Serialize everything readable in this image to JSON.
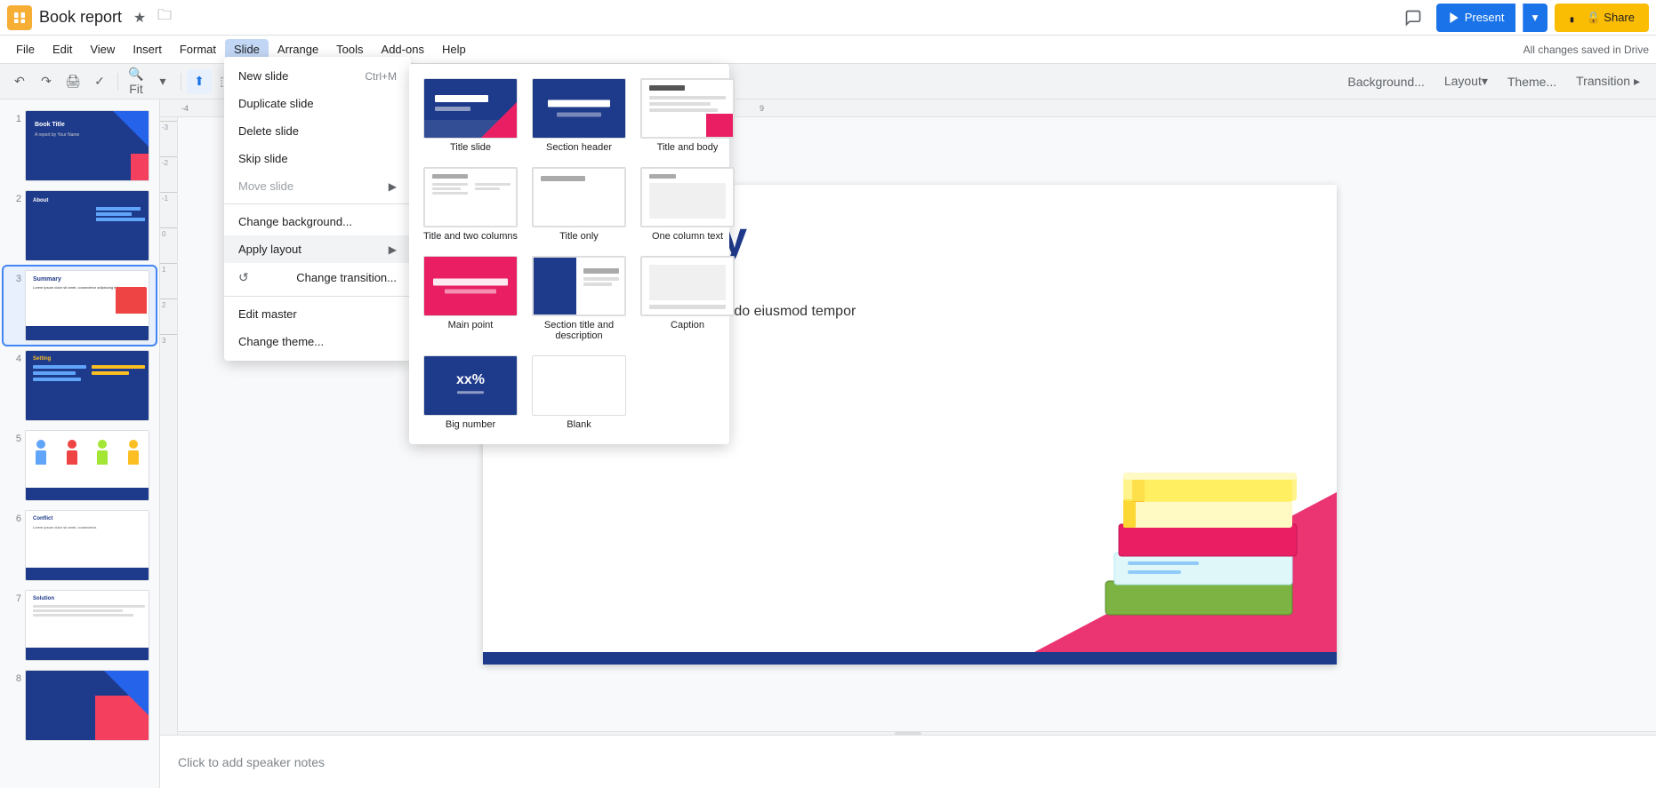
{
  "app": {
    "icon_color": "#f6ae35",
    "title": "Book report",
    "autosave": "All changes saved in Drive"
  },
  "title_bar": {
    "star_icon": "★",
    "folder_icon": "📁",
    "present_label": "Present",
    "share_label": "🔒 Share"
  },
  "menu": {
    "items": [
      "File",
      "Edit",
      "View",
      "Insert",
      "Format",
      "Slide",
      "Arrange",
      "Tools",
      "Add-ons",
      "Help"
    ]
  },
  "toolbar": {
    "zoom_label": "Fit",
    "zoom_icon": "🔍"
  },
  "slide_menu": {
    "items": [
      {
        "label": "New slide",
        "shortcut": "Ctrl+M",
        "disabled": false,
        "has_arrow": false,
        "has_icon": false
      },
      {
        "label": "Duplicate slide",
        "shortcut": "",
        "disabled": false,
        "has_arrow": false,
        "has_icon": false
      },
      {
        "label": "Delete slide",
        "shortcut": "",
        "disabled": false,
        "has_arrow": false,
        "has_icon": false
      },
      {
        "label": "Skip slide",
        "shortcut": "",
        "disabled": false,
        "has_arrow": false,
        "has_icon": false
      },
      {
        "label": "Move slide",
        "shortcut": "",
        "disabled": true,
        "has_arrow": true,
        "has_icon": false
      },
      {
        "divider": true
      },
      {
        "label": "Change background...",
        "shortcut": "",
        "disabled": false,
        "has_arrow": false,
        "has_icon": false
      },
      {
        "label": "Apply layout",
        "shortcut": "",
        "disabled": false,
        "has_arrow": true,
        "has_icon": false
      },
      {
        "label": "Change transition...",
        "shortcut": "",
        "disabled": false,
        "has_arrow": false,
        "has_icon": true
      },
      {
        "divider": true
      },
      {
        "label": "Edit master",
        "shortcut": "",
        "disabled": false,
        "has_arrow": false,
        "has_icon": false
      },
      {
        "label": "Change theme...",
        "shortcut": "",
        "disabled": false,
        "has_arrow": false,
        "has_icon": false
      }
    ]
  },
  "layout_submenu": {
    "layouts": [
      {
        "name": "Title slide",
        "type": "title-slide"
      },
      {
        "name": "Section header",
        "type": "section"
      },
      {
        "name": "Title and body",
        "type": "title-body"
      },
      {
        "name": "Title and two columns",
        "type": "two-col"
      },
      {
        "name": "Title only",
        "type": "title-only"
      },
      {
        "name": "One column text",
        "type": "one-col"
      },
      {
        "name": "Main point",
        "type": "main-point"
      },
      {
        "name": "Section title and description",
        "type": "section-desc"
      },
      {
        "name": "Caption",
        "type": "caption"
      },
      {
        "name": "Big number",
        "type": "big-num"
      },
      {
        "name": "Blank",
        "type": "blank"
      }
    ]
  },
  "slides": [
    {
      "num": "1",
      "type": "title"
    },
    {
      "num": "2",
      "type": "about"
    },
    {
      "num": "3",
      "type": "summary",
      "active": true
    },
    {
      "num": "4",
      "type": "setting"
    },
    {
      "num": "5",
      "type": "characters"
    },
    {
      "num": "6",
      "type": "conflict"
    },
    {
      "num": "7",
      "type": "solution"
    },
    {
      "num": "8",
      "type": "end"
    }
  ],
  "active_slide": {
    "title": "Summary",
    "body": "consectetur adipiscing elit, sed do eiusmod tempor magna aliqua."
  },
  "toolbar_buttons": {
    "background_label": "Background...",
    "layout_label": "Layout▾",
    "theme_label": "Theme...",
    "transition_label": "Transition ▸"
  },
  "notes": {
    "placeholder": "Click to add speaker notes"
  },
  "ruler": {
    "ticks": [
      "-4",
      "-3",
      "-2",
      "-1",
      "0",
      "1",
      "2",
      "3",
      "4",
      "5",
      "6",
      "7",
      "8",
      "9"
    ]
  }
}
